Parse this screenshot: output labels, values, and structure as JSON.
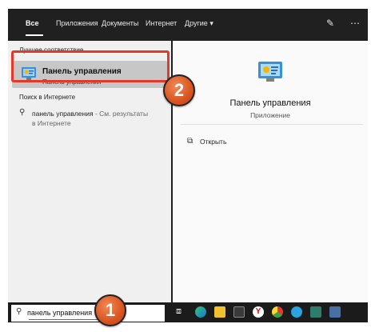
{
  "tabs": [
    {
      "label": "Все",
      "active": true
    },
    {
      "label": "Приложения"
    },
    {
      "label": "Документы"
    },
    {
      "label": "Интернет"
    },
    {
      "label": "Другие ▾"
    }
  ],
  "toolbar_icons": [
    "feedback-icon",
    "more-icon"
  ],
  "left": {
    "best_match_label": "Лучшее соответствие",
    "best_match": {
      "title": "Панель управления",
      "subtitle": "Панель управления"
    },
    "web_label": "Поиск в Интернете",
    "web_query": "панель управления",
    "web_suffix": " - См. результаты",
    "web_suffix2": "в Интернете"
  },
  "right": {
    "title": "Панель управления",
    "subtitle": "Приложение",
    "actions": [
      {
        "label": "Открыть"
      }
    ]
  },
  "taskbar": {
    "search_value": "панель управления",
    "apps": [
      "task-view-icon",
      "edge-icon",
      "explorer-icon",
      "store-icon",
      "yandex-icon",
      "chrome-icon",
      "telegram-icon",
      "image-app-icon",
      "monitor-app-icon"
    ]
  },
  "callouts": [
    "1",
    "2"
  ],
  "colors": {
    "accent": "#e2392b",
    "callout": "#d9541f"
  }
}
